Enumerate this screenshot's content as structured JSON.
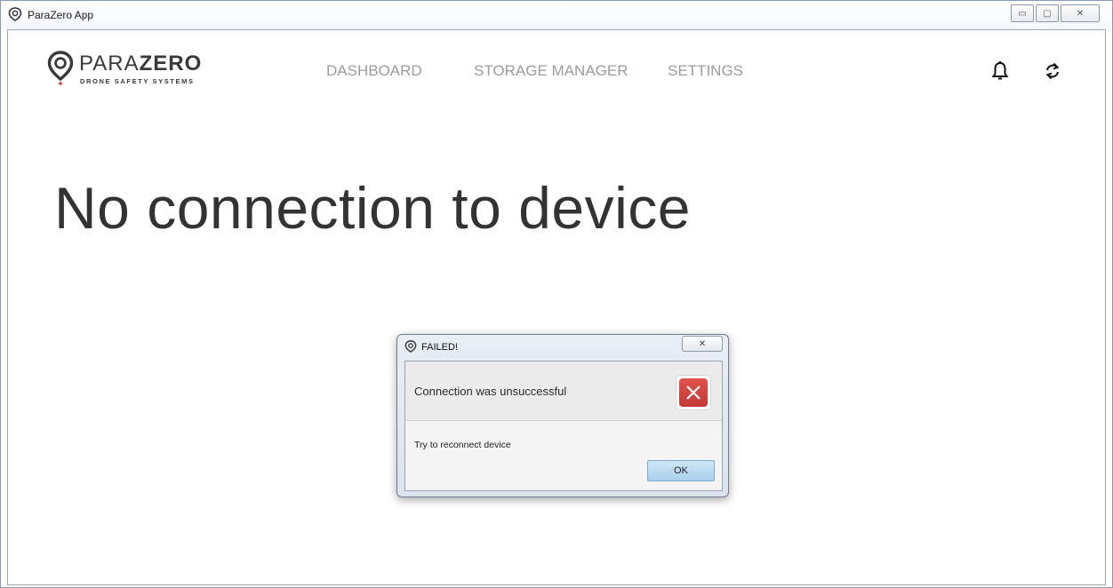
{
  "window": {
    "title": "ParaZero App",
    "controls": {
      "minimize": "▭",
      "maximize": "▢",
      "close": "✕"
    }
  },
  "header": {
    "logo": {
      "name_light": "PARA",
      "name_bold": "ZERO",
      "tagline": "DRONE SAFETY SYSTEMS"
    },
    "nav": {
      "dashboard": "DASHBOARD",
      "storage_manager": "STORAGE MANAGER",
      "settings": "SETTINGS"
    },
    "icons": {
      "notifications": "bell-icon",
      "refresh": "sync-icon"
    }
  },
  "main": {
    "headline": "No connection to device"
  },
  "dialog": {
    "title": "FAILED!",
    "close": "✕",
    "header_text": "Connection was unsuccessful",
    "content_text": "Try to reconnect device",
    "ok_label": "OK",
    "icon": "error-icon"
  },
  "colors": {
    "nav_text": "#9c9c9c",
    "headline": "#333333",
    "error_red": "#d0423d",
    "ok_button": "#bcdcf2",
    "logo_accent": "#d0423d"
  }
}
